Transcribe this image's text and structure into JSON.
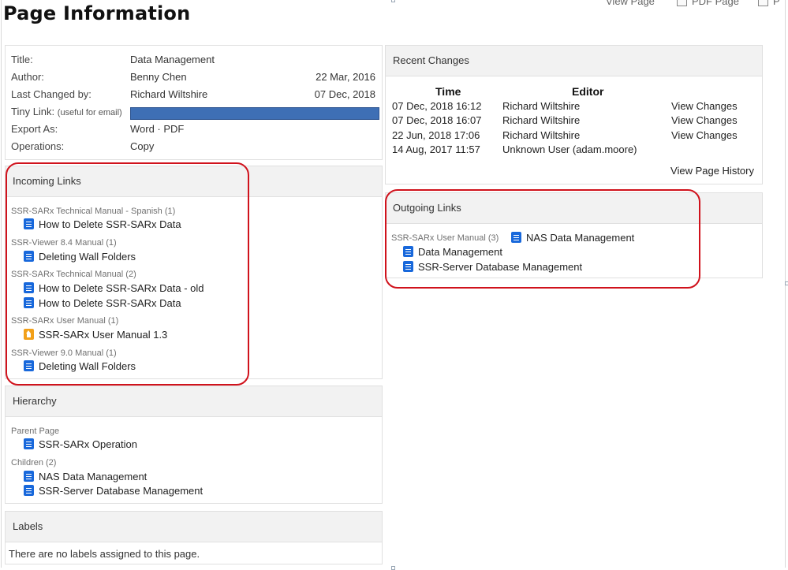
{
  "page": {
    "title": "Page Information"
  },
  "top_actions": {
    "view_page": "View Page",
    "pdf_page": "PDF Page",
    "more": "P"
  },
  "page_info": {
    "rows": [
      {
        "label": "Title:",
        "value": "Data Management",
        "date": ""
      },
      {
        "label": "Author:",
        "value": "Benny Chen",
        "date": "22 Mar, 2016"
      },
      {
        "label": "Last Changed by:",
        "value": "Richard Wiltshire",
        "date": "07 Dec, 2018"
      },
      {
        "label": "Tiny Link:",
        "note": "(useful for email)",
        "value": "",
        "date": ""
      },
      {
        "label": "Export As:",
        "value": "Word · PDF",
        "date": ""
      },
      {
        "label": "Operations:",
        "value": "Copy",
        "date": ""
      }
    ]
  },
  "incoming_links": {
    "heading": "Incoming Links",
    "groups": [
      {
        "label": "SSR-SARx Technical Manual - Spanish (1)",
        "items": [
          {
            "text": "How to Delete SSR-SARx Data",
            "icon": "document-icon"
          }
        ]
      },
      {
        "label": "SSR-Viewer 8.4 Manual (1)",
        "items": [
          {
            "text": "Deleting Wall Folders",
            "icon": "document-icon"
          }
        ]
      },
      {
        "label": "SSR-SARx Technical Manual (2)",
        "items": [
          {
            "text": "How to Delete SSR-SARx Data - old",
            "icon": "document-icon"
          },
          {
            "text": "How to Delete SSR-SARx Data",
            "icon": "document-icon"
          }
        ]
      },
      {
        "label": "SSR-SARx User Manual (1)",
        "items": [
          {
            "text": "SSR-SARx User Manual 1.3",
            "icon": "home-icon"
          }
        ]
      },
      {
        "label": "SSR-Viewer 9.0 Manual (1)",
        "items": [
          {
            "text": "Deleting Wall Folders",
            "icon": "document-icon"
          }
        ]
      }
    ]
  },
  "hierarchy": {
    "heading": "Hierarchy",
    "parent_label": "Parent Page",
    "parent": "SSR-SARx Operation",
    "children_label": "Children (2)",
    "children": [
      "NAS Data Management",
      "SSR-Server Database Management"
    ]
  },
  "labels": {
    "heading": "Labels",
    "empty_text": "There are no labels assigned to this page."
  },
  "recent_changes": {
    "heading": "Recent Changes",
    "columns": {
      "time": "Time",
      "editor": "Editor"
    },
    "rows": [
      {
        "time": "07 Dec, 2018 16:12",
        "editor": "Richard Wiltshire",
        "action": "View Changes"
      },
      {
        "time": "07 Dec, 2018 16:07",
        "editor": "Richard Wiltshire",
        "action": "View Changes"
      },
      {
        "time": "22 Jun, 2018 17:06",
        "editor": "Richard Wiltshire",
        "action": "View Changes"
      },
      {
        "time": "14 Aug, 2017 11:57",
        "editor": "Unknown User (adam.moore)",
        "action": ""
      }
    ],
    "history_link": "View Page History"
  },
  "outgoing_links": {
    "heading": "Outgoing Links",
    "group_label": "SSR-SARx User Manual (3)",
    "items": [
      "NAS Data Management",
      "Data Management",
      "SSR-Server Database Management"
    ]
  },
  "colors": {
    "highlight": "#d0121c",
    "doc_icon": "#1868db",
    "home_icon": "#f2a019",
    "tiny_link_bar": "#3e6fb5"
  }
}
